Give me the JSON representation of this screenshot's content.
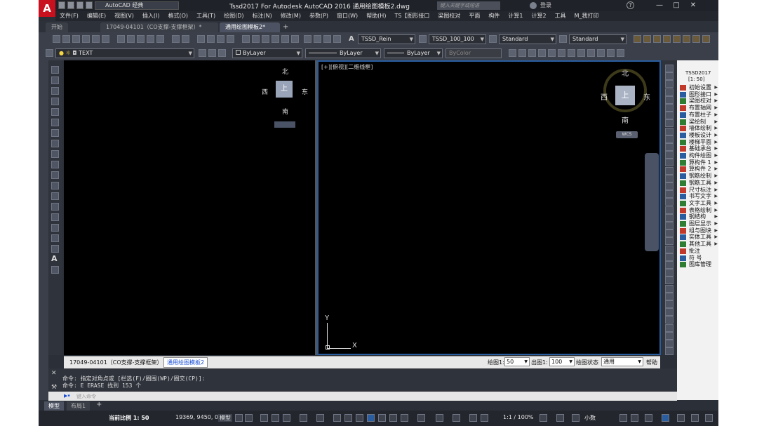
{
  "app": {
    "logo": "A",
    "workspace": "AutoCAD 经典",
    "title": "Tssd2017 For Autodesk AutoCAD 2016    通用绘图模板2.dwg",
    "search_placeholder": "键入关键字或短语",
    "signin": "登录"
  },
  "menu": [
    "文件(F)",
    "编辑(E)",
    "视图(V)",
    "插入(I)",
    "格式(O)",
    "工具(T)",
    "绘图(D)",
    "标注(N)",
    "修改(M)",
    "参数(P)",
    "窗口(W)",
    "帮助(H)",
    "TS【图形接口",
    "梁图校对",
    "平面",
    "构件",
    "计算1",
    "计算2",
    "工具",
    "M_我打印"
  ],
  "tabs": [
    "开始",
    "17049-04101（CO支撑-支撑框架）*",
    "通用绘图模板2*"
  ],
  "toolbar1": {
    "text_style": "TSSD_Rein",
    "dim_style": "TSSD_100_100",
    "table_style": "Standard",
    "mleader_style": "Standard"
  },
  "toolbar2": {
    "layer": "TEXT",
    "color": "ByLayer",
    "linetype": "ByLayer",
    "lineweight": "ByLayer",
    "plotstyle": "ByColor"
  },
  "viewport_left": {
    "compass": {
      "north": "北",
      "south": "南",
      "east": "东",
      "west": "西",
      "top": "上"
    }
  },
  "viewport_right": {
    "label": "[+][俯视][二维线框]",
    "compass": {
      "north": "北",
      "south": "南",
      "east": "东",
      "west": "西",
      "top": "上"
    },
    "wcs": "WCS",
    "ucs_x": "X",
    "ucs_y": "Y"
  },
  "tssd_panel": {
    "header": "TSSD2017",
    "scale": "[1: 50]",
    "items": [
      "初始设置",
      "图形接口",
      "梁图校对",
      "布置轴网",
      "布置柱子",
      "梁绘制",
      "墙体绘制",
      "楼板设计",
      "楼梯平面",
      "基础承台",
      "构件绘图",
      "算构件 1",
      "算构件 2",
      "钢筋绘制",
      "钢筋工具",
      "尺寸标注",
      "书写文字",
      "文字工具",
      "表格绘制",
      "钢结构",
      "图层显示",
      "组与图块",
      "实体工具",
      "其他工具",
      "批注",
      "符 号",
      "图库管理"
    ]
  },
  "layout_tabs": {
    "file1": "17049-04101（CO支撑-支撑框架）",
    "file2": "通用绘图模板2",
    "draw_scale_label": "绘图1:",
    "draw_scale": "50",
    "out_scale_label": "出图1:",
    "out_scale": "100",
    "draw_state_label": "绘图状态",
    "draw_state": "通用",
    "help": "帮助"
  },
  "command": {
    "line1": "命令: 指定对角点或 [栏选(F)/圈围(WP)/圈交(CP)]:",
    "line2": "命令: E ERASE 找到 153 个",
    "prompt": "键入命令"
  },
  "model_tabs": [
    "模型",
    "布局1"
  ],
  "statusbar": {
    "current_scale": "当前比例 1: 50",
    "coords": "19369, 9450, 0",
    "model": "模型",
    "annoscale": "1:1 / 100%",
    "units": "小数"
  }
}
